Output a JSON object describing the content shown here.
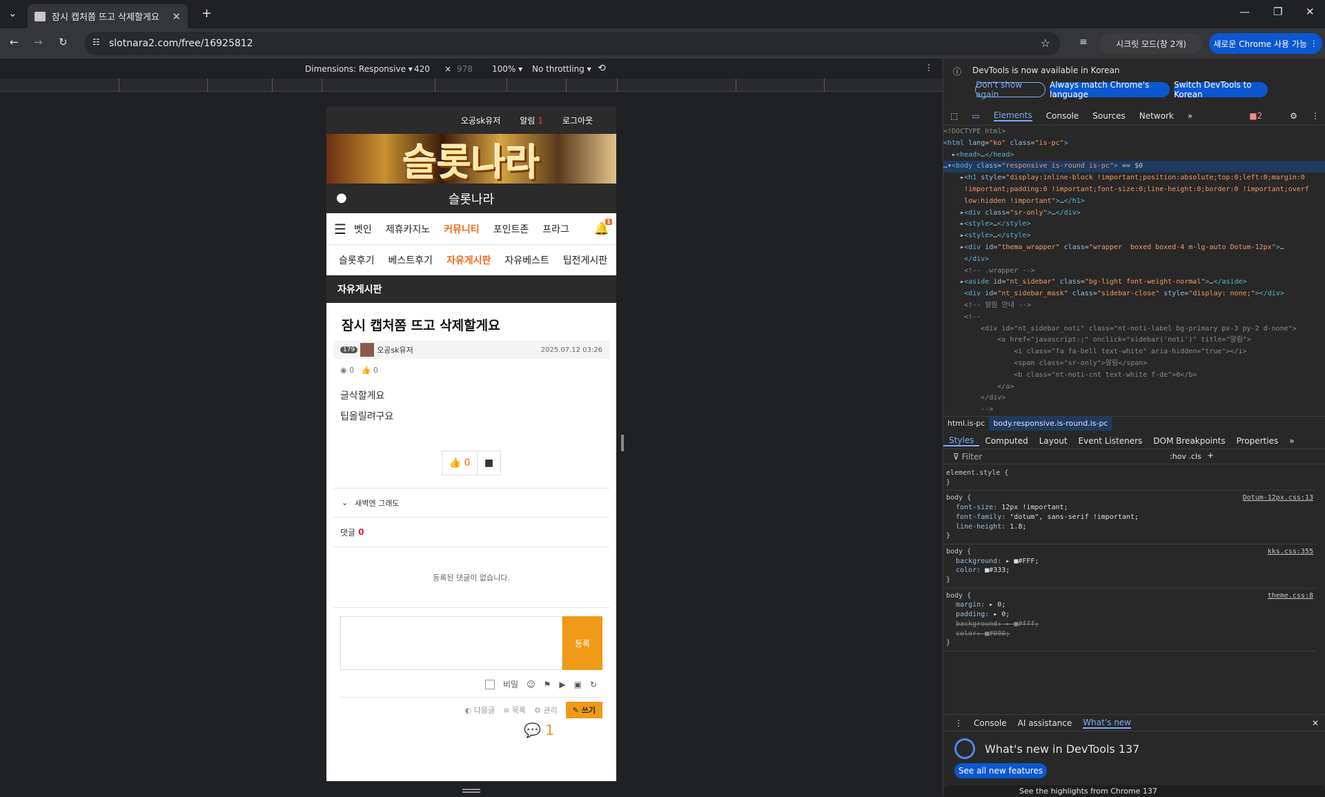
{
  "browser": {
    "tab_title": "잠시 캡처쫌 뜨고 삭제할게요",
    "url": "slotnara2.com/free/16925812",
    "incognito_label": "시크릿 모드(창 2개)",
    "new_chrome_label": "새로운 Chrome 사용 가능"
  },
  "device_toolbar": {
    "dimensions": "Dimensions: Responsive",
    "width": "420",
    "height": "978",
    "zoom": "100%",
    "throttling": "No throttling"
  },
  "site": {
    "top_links": [
      "오공sk유저",
      "알림",
      "로그아웃"
    ],
    "alert_count": "1",
    "banner_text": "슬롯나라",
    "brand": "슬롯나라",
    "nav1": [
      "벳인",
      "제휴카지노",
      "커뮤니티",
      "포인트존",
      "프라그"
    ],
    "nav1_active": "커뮤니티",
    "bell_badge": "1",
    "nav2": [
      "슬롯후기",
      "베스트후기",
      "자유게시판",
      "자유베스트",
      "팁전게시판"
    ],
    "nav2_active": "자유게시판",
    "board_title": "자유게시판",
    "post": {
      "title": "잠시 캡처쫌 뜨고 삭제할게요",
      "level": "179",
      "author": "오공sk유저",
      "date": "2025.07.12 03:26",
      "views": "0",
      "likes": "0",
      "body": [
        "글삭할게요",
        "팁올릴려구요"
      ],
      "like_count": "0"
    },
    "related": "새벽엔 그래도",
    "comments_label": "댓글",
    "comments_count": "0",
    "empty_comments": "등록된 댓글이 없습니다.",
    "submit_label": "등록",
    "secret_label": "비밀",
    "footer_links": [
      "다음글",
      "목록",
      "관리"
    ],
    "write_label": "쓰기",
    "bottom_count": "1"
  },
  "devtools": {
    "info_text": "DevTools is now available in Korean",
    "btn_dont": "Don't show again",
    "btn_match": "Always match Chrome's language",
    "btn_switch": "Switch DevTools to Korean",
    "tabs": [
      "Elements",
      "Console",
      "Sources",
      "Network"
    ],
    "error_count": "2",
    "breadcrumbs": [
      "html.is-pc",
      "body.responsive.is-round.is-pc"
    ],
    "style_tabs": [
      "Styles",
      "Computed",
      "Layout",
      "Event Listeners",
      "DOM Breakpoints",
      "Properties"
    ],
    "filter_placeholder": "Filter",
    "filter_opts": ":hov .cls",
    "drawer_tabs": [
      "Console",
      "AI assistance",
      "What's new"
    ],
    "whats_new_title": "What's new in DevTools 137",
    "see_all": "See all new features",
    "highlights": "See the highlights from Chrome 137",
    "new_badge": "new"
  }
}
